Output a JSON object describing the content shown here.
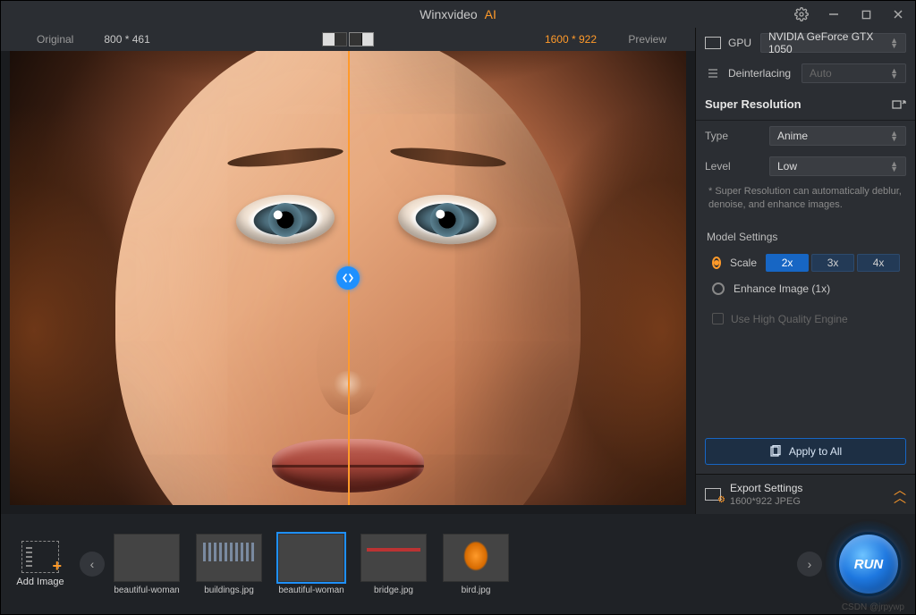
{
  "titlebar": {
    "app_name": "Winxvideo",
    "app_suffix": "AI"
  },
  "compare": {
    "original_label": "Original",
    "original_dims": "800 * 461",
    "new_dims": "1600 * 922",
    "preview_label": "Preview"
  },
  "panel": {
    "gpu_label": "GPU",
    "gpu_value": "NVIDIA GeForce GTX 1050",
    "deint_label": "Deinterlacing",
    "deint_value": "Auto",
    "sr_header": "Super Resolution",
    "type_label": "Type",
    "type_value": "Anime",
    "level_label": "Level",
    "level_value": "Low",
    "hint": "* Super Resolution can automatically deblur, denoise, and enhance images.",
    "model_settings": "Model Settings",
    "scale_label": "Scale",
    "scales": {
      "s2": "2x",
      "s3": "3x",
      "s4": "4x"
    },
    "enhance_label": "Enhance Image (1x)",
    "hq_label": "Use High Quality Engine",
    "apply_label": "Apply to All",
    "export_title": "Export Settings",
    "export_sub": "1600*922  JPEG"
  },
  "bottom": {
    "add_label": "Add Image",
    "thumbs": [
      {
        "caption": "beautiful-woman"
      },
      {
        "caption": "buildings.jpg"
      },
      {
        "caption": "beautiful-woman"
      },
      {
        "caption": "bridge.jpg"
      },
      {
        "caption": "bird.jpg"
      }
    ],
    "run_label": "RUN"
  },
  "watermark": "CSDN @jrpywp"
}
